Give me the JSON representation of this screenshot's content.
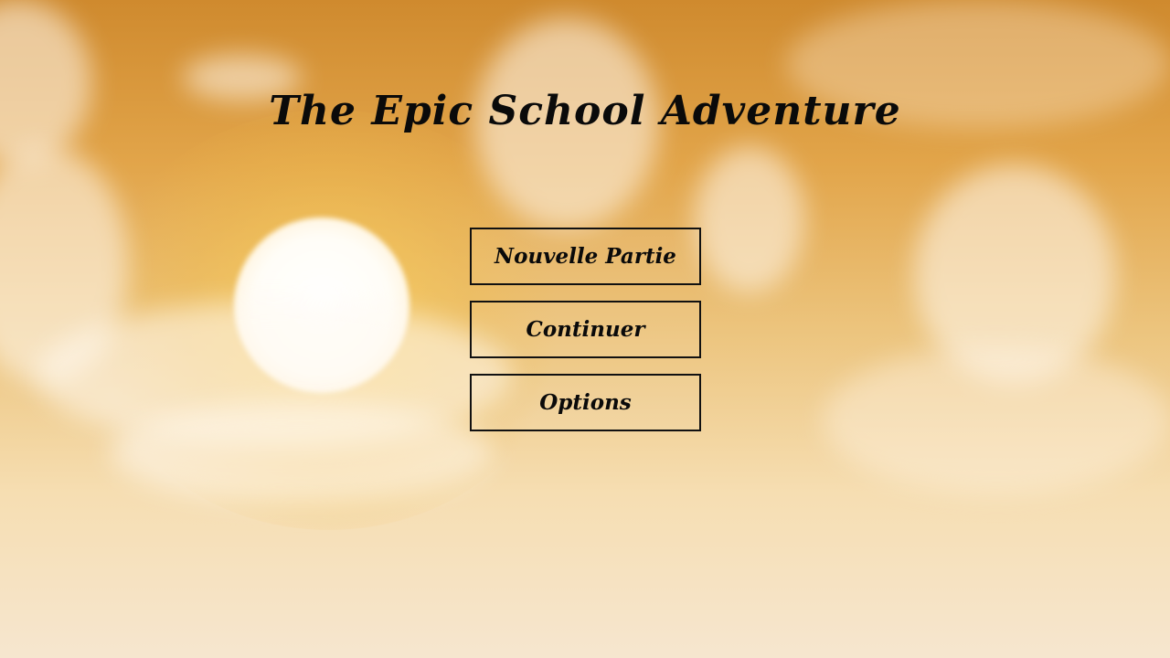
{
  "game": {
    "title": "The Epic School Adventure"
  },
  "menu": {
    "new_game_label": "Nouvelle Partie",
    "continue_label": "Continuer",
    "options_label": "Options"
  },
  "colors": {
    "sky_top": "#cf8a2e",
    "sky_bottom": "#f6e6cf",
    "sun": "#ffffff",
    "text": "#0a0a0a",
    "button_border": "#111111"
  }
}
